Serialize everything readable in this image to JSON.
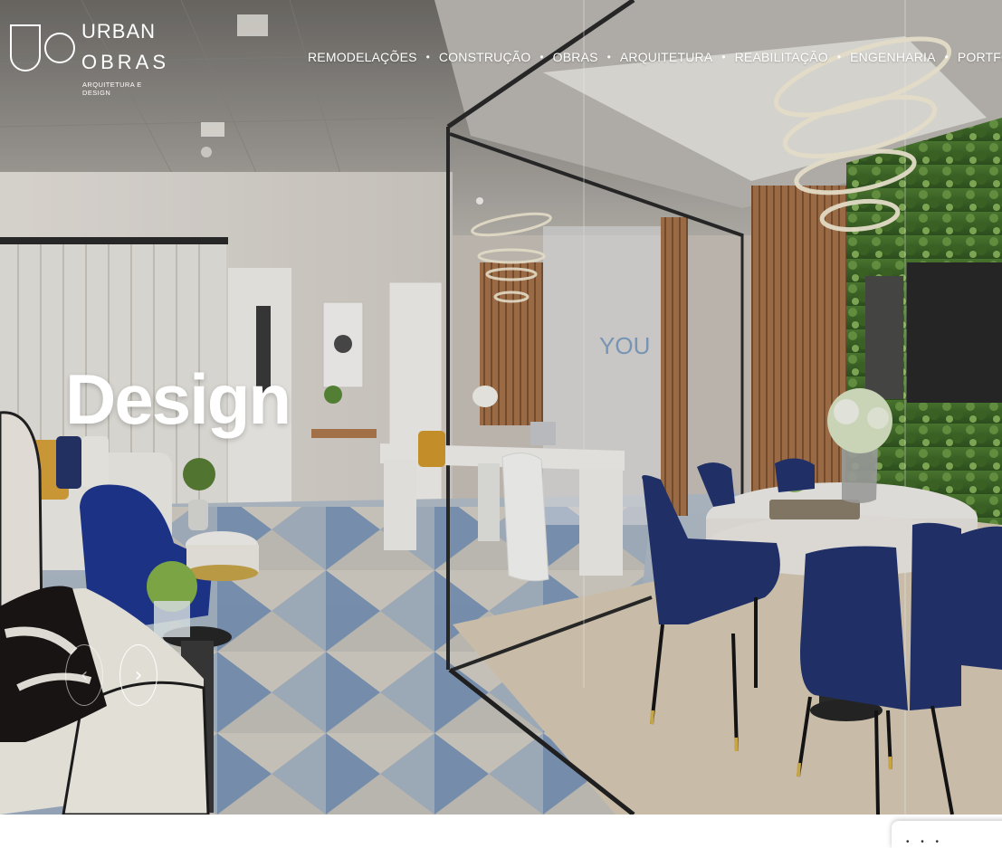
{
  "brand": {
    "name_line_1": "URBAN",
    "name_line_2": "OBRAS",
    "tagline": "ARQUITETURA E DESIGN"
  },
  "nav": {
    "items": [
      {
        "label": "REMODELAÇÕES"
      },
      {
        "label": "CONSTRUÇÃO"
      },
      {
        "label": "OBRAS"
      },
      {
        "label": "ARQUITETURA"
      },
      {
        "label": "REABILITAÇÃO"
      },
      {
        "label": "ENGENHARIA"
      },
      {
        "label": "PORTFÓLIO"
      }
    ],
    "separator": "•"
  },
  "hero": {
    "slide_title": "Design",
    "wall_sign": "YOU",
    "prev_icon": "chevron-left-icon",
    "next_icon": "chevron-right-icon",
    "prev_glyph": "‹",
    "next_glyph": "›"
  },
  "chat_tab": {
    "icon": "chat-icon",
    "glyph": "• • •"
  },
  "colors": {
    "nav_text": "#ffffff",
    "wall": "#d8d3cc",
    "wood": "#a8744a",
    "green_wall": "#3e6b2a",
    "navy_chair": "#24376e",
    "table": "#eae7e2"
  }
}
